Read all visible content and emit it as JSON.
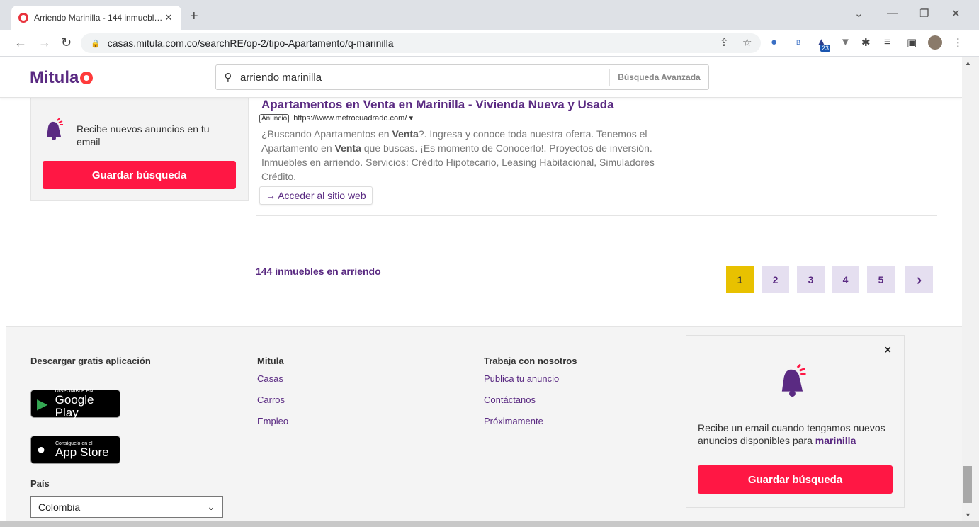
{
  "browser": {
    "tab_title": "Arriendo Marinilla - 144 inmuebl…",
    "url": "casas.mitula.com.co/searchRE/op-2/tipo-Apartamento/q-marinilla",
    "extension_badge": "23"
  },
  "site": {
    "logo": "Mitula",
    "search_value": "arriendo marinilla",
    "advanced_search": "Búsqueda Avanzada"
  },
  "alert": {
    "text": "Recibe nuevos anuncios en tu email",
    "button": "Guardar búsqueda"
  },
  "ad": {
    "title": "Apartamentos en Venta en Marinilla - Vivienda Nueva y Usada",
    "tag": "Anuncio",
    "url": "https://www.metrocuadrado.com/",
    "desc_1": "¿Buscando Apartamentos en ",
    "desc_b1": "Venta",
    "desc_2": "?. Ingresa y conoce toda nuestra oferta. Tenemos el Apartamento en ",
    "desc_b2": "Venta",
    "desc_3": " que buscas. ¡Es momento de Conocerlo!. Proyectos de inversión. Inmuebles en arriendo. Servicios: Crédito Hipotecario, Leasing Habitacional, Simuladores Crédito.",
    "visit": "→ Acceder al sitio web"
  },
  "results": {
    "count_text": "144 inmuebles en arriendo",
    "pages": [
      "1",
      "2",
      "3",
      "4",
      "5"
    ],
    "active_page": "1",
    "next": "›"
  },
  "footer": {
    "download_title": "Descargar gratis aplicación",
    "google_small": "DISPONIBLE EN",
    "google_big": "Google Play",
    "apple_small": "Consíguelo en el",
    "apple_big": "App Store",
    "country_label": "País",
    "country_value": "Colombia",
    "col2_title": "Mitula",
    "col2_links": [
      "Casas",
      "Carros",
      "Empleo"
    ],
    "col3_title": "Trabaja con nosotros",
    "col3_links": [
      "Publica tu anuncio",
      "Contáctanos",
      "Próximamente"
    ],
    "popup_msg": "Recibe un email cuando tengamos nuevos anuncios disponibles para ",
    "popup_term": "marinilla",
    "popup_button": "Guardar búsqueda",
    "popup_close": "×"
  },
  "colors": {
    "brand_purple": "#5a2a82",
    "brand_red": "#ff1744",
    "active_page": "#e8c100"
  }
}
